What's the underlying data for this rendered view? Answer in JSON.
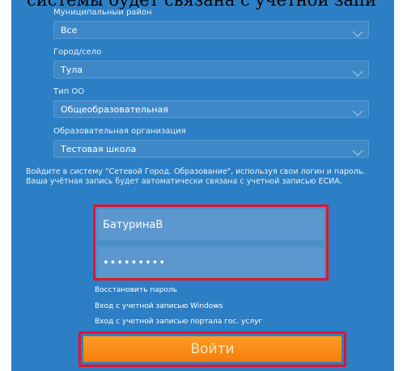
{
  "page": {
    "top_text": "системы будет связана с учетной запи"
  },
  "form": {
    "district_label": "Муниципальный район",
    "district_value": "Все",
    "city_label": "Город/село",
    "city_value": "Тула",
    "org_type_label": "Тип ОО",
    "org_type_value": "Общеобразовательная",
    "org_label": "Образовательная организация",
    "org_value": "Тестовая школа"
  },
  "info_text": "Войдите в систему \"Сетевой Город. Образование\", используя свои логин и пароль. Ваша учётная запись будет автоматически связана с учетной записью ЕСИА.",
  "login": {
    "username_value": "БатуринаВ",
    "password_value": "•••••••••"
  },
  "links": {
    "restore_password": "Восстановить пароль",
    "windows_login": "Вход с учетной записью Windows",
    "gosuslugi_login": "Вход с учетной записью портала гос. услуг"
  },
  "buttons": {
    "login": "Войти"
  },
  "colors": {
    "panel_bg": "#2c7fc5",
    "button_orange": "#f7861a",
    "highlight_red": "#e0162a"
  }
}
